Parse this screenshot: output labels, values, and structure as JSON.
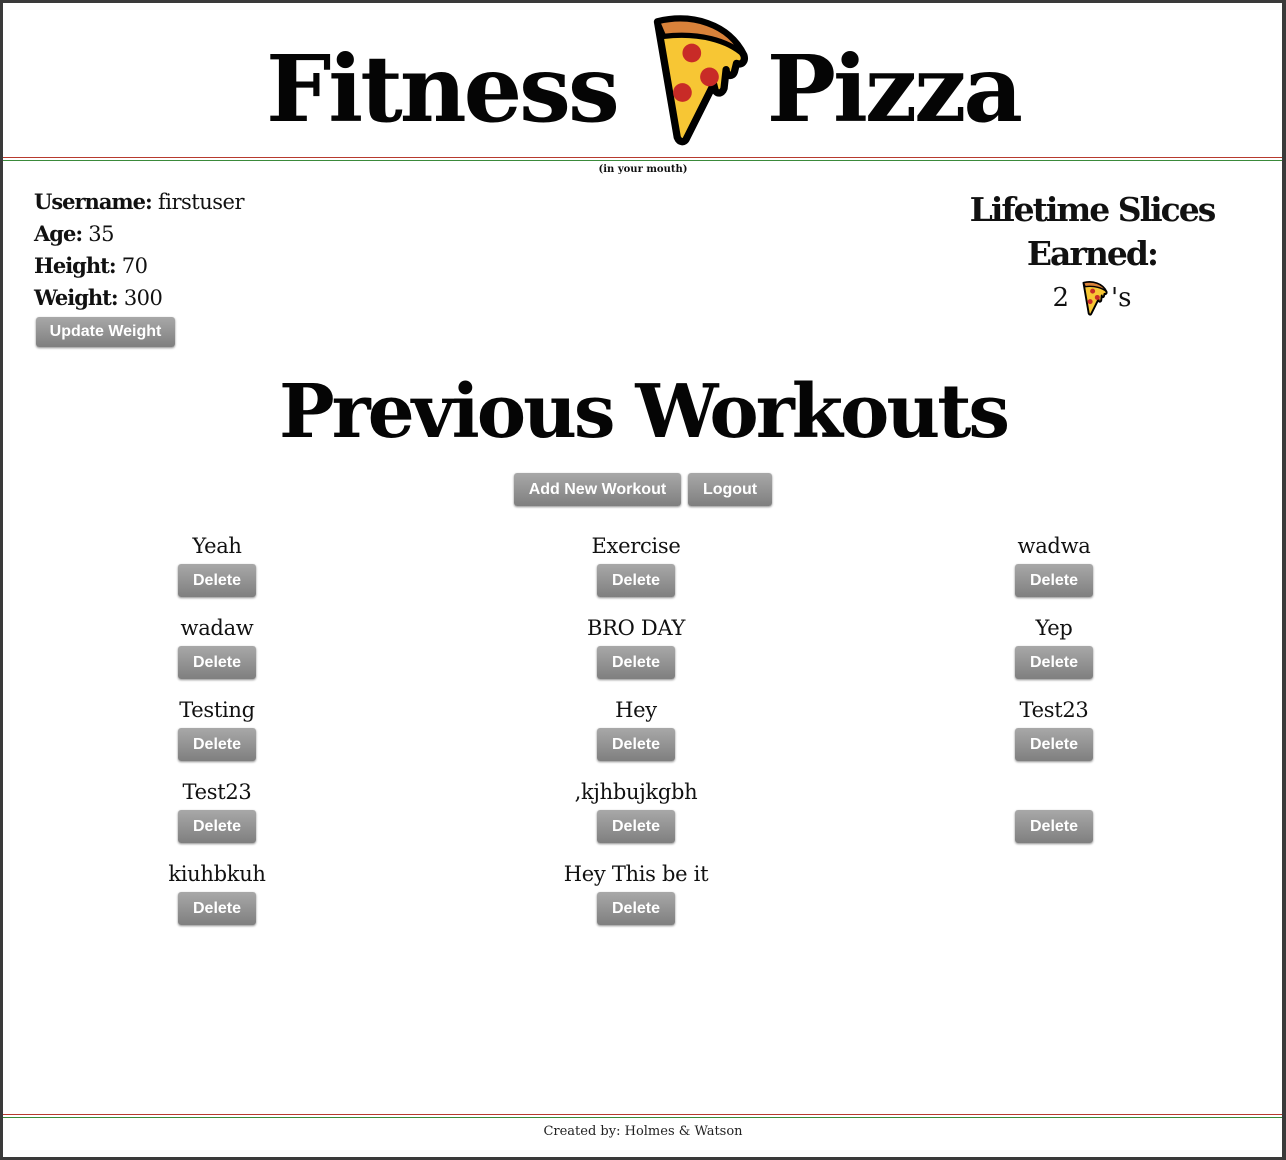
{
  "header": {
    "title_left": "Fitness",
    "title_right": "Pizza",
    "logo_icon": "pizza-slice-icon",
    "subtitle": "(in your mouth)"
  },
  "profile": {
    "username_label": "Username:",
    "username": "firstuser",
    "age_label": "Age:",
    "age": "35",
    "height_label": "Height:",
    "height": "70",
    "weight_label": "Weight:",
    "weight": "300",
    "update_weight_label": "Update Weight"
  },
  "slices": {
    "title": "Lifetime Slices Earned:",
    "count": "2",
    "suffix": "'s"
  },
  "workouts_section": {
    "title": "Previous Workouts",
    "add_label": "Add New Workout",
    "logout_label": "Logout",
    "delete_label": "Delete"
  },
  "workouts": {
    "col1": [
      "Yeah",
      "wadaw",
      "Testing",
      "Test23",
      "kiuhbkuh"
    ],
    "col2": [
      "Exercise",
      "BRO DAY",
      "Hey",
      ",kjhbujkgbh",
      "Hey This be it"
    ],
    "col3": [
      "wadwa",
      "Yep",
      "Test23",
      ""
    ]
  },
  "footer": {
    "credit": "Created by: Holmes & Watson"
  },
  "colors": {
    "rule_red": "#b73a2e",
    "rule_green": "#3a8a3a",
    "button_top": "#a8a8a8",
    "button_bottom": "#7f7f7f"
  }
}
